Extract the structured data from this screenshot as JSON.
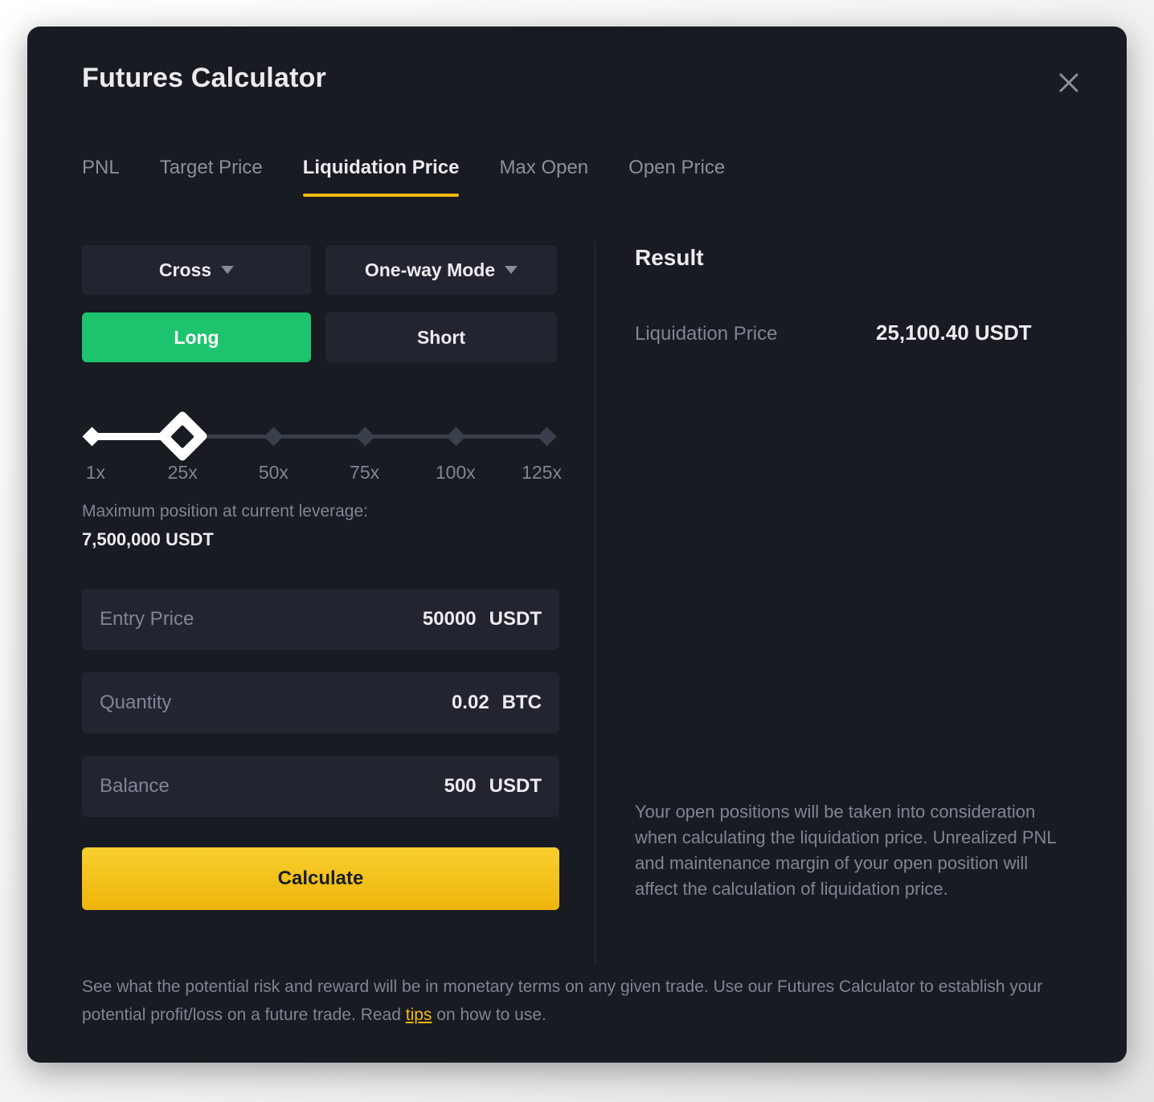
{
  "dialog": {
    "title": "Futures Calculator",
    "close_icon": "close-icon"
  },
  "tabs": [
    {
      "label": "PNL",
      "active": false
    },
    {
      "label": "Target Price",
      "active": false
    },
    {
      "label": "Liquidation Price",
      "active": true
    },
    {
      "label": "Max Open",
      "active": false
    },
    {
      "label": "Open Price",
      "active": false
    }
  ],
  "form": {
    "margin_mode": {
      "value": "Cross",
      "caret_icon": "chevron-down-icon"
    },
    "position_mode": {
      "value": "One-way Mode",
      "caret_icon": "chevron-down-icon"
    },
    "side": {
      "long_label": "Long",
      "short_label": "Short",
      "selected": "Long"
    },
    "leverage": {
      "current": "25x",
      "ticks": [
        "1x",
        "25x",
        "50x",
        "75x",
        "100x",
        "125x"
      ],
      "tick_positions_pct": [
        0,
        20,
        40,
        60,
        80,
        100
      ],
      "thumb_position_pct": 20
    },
    "max_position": {
      "caption": "Maximum position at current leverage:",
      "value": "7,500,000 USDT"
    },
    "fields": [
      {
        "label": "Entry Price",
        "value": "50000",
        "unit": "USDT",
        "placeholder": "Entry Price"
      },
      {
        "label": "Quantity",
        "value": "0.02",
        "unit": "BTC",
        "placeholder": "Quantity"
      },
      {
        "label": "Balance",
        "value": "500",
        "unit": "USDT",
        "placeholder": "Balance"
      }
    ],
    "calculate_label": "Calculate"
  },
  "result": {
    "title": "Result",
    "label": "Liquidation Price",
    "value": "25,100.40 USDT",
    "note": "Your open positions will be taken into consideration when calculating the liquidation price. Unrealized PNL and maintenance margin of your open position will affect the calculation of liquidation price."
  },
  "footer": {
    "text_before": "See what the potential risk and reward will be in monetary terms on any given trade. Use our Futures Calculator to establish your potential profit/loss on a future trade. Read ",
    "link_label": "tips",
    "text_after": " on how to use."
  },
  "colors": {
    "accent_yellow": "#f0b90b",
    "long_green": "#1ec46d",
    "modal_bg": "#181b22",
    "field_bg": "#222530",
    "text_primary": "#eaecef",
    "text_muted": "#7e8594"
  }
}
